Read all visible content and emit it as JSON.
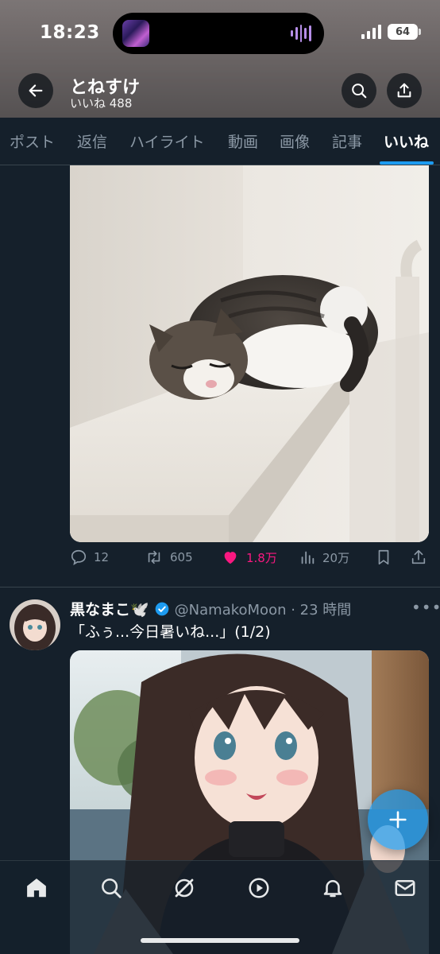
{
  "status_bar": {
    "time": "18:23",
    "battery": "64"
  },
  "header": {
    "name": "とねすけ",
    "subtitle": "いいね 488"
  },
  "tabs": [
    {
      "label": "ポスト",
      "active": false
    },
    {
      "label": "返信",
      "active": false
    },
    {
      "label": "ハイライト",
      "active": false
    },
    {
      "label": "動画",
      "active": false
    },
    {
      "label": "画像",
      "active": false
    },
    {
      "label": "記事",
      "active": false
    },
    {
      "label": "いいね",
      "active": true
    }
  ],
  "tweet1": {
    "image_icon": "sleeping-cat-photo",
    "actions": {
      "reply_count": "12",
      "repost_count": "605",
      "like_count": "1.8万",
      "view_count": "20万"
    }
  },
  "tweet2": {
    "author": "黒なまこ🕊️",
    "handle_time": "@NamakoMoon · 23 時間",
    "text": "「ふぅ...今日暑いね...」(1/2)",
    "image_icon": "anime-girl-illustration"
  },
  "colors": {
    "accent": "#1d9bf0",
    "like": "#f91880",
    "background": "#15202b",
    "muted": "#8b98a5"
  }
}
